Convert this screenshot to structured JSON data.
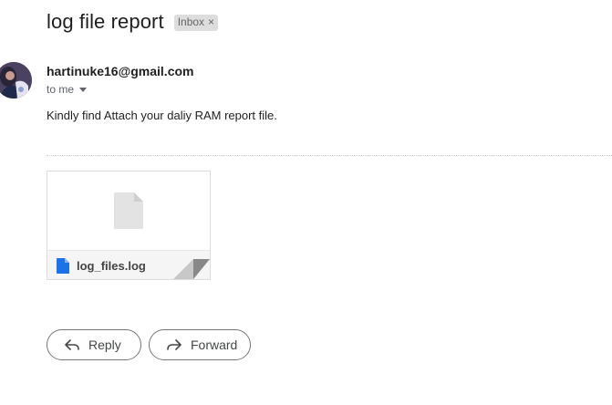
{
  "email": {
    "subject": "log file report",
    "label": "Inbox",
    "label_close": "×",
    "sender": "hartinuke16@gmail.com",
    "recipient": "to me",
    "body": "Kindly find Attach your daliy RAM report file."
  },
  "attachment": {
    "filename": "log_files.log",
    "icon": "document-icon"
  },
  "actions": {
    "reply_label": "Reply",
    "forward_label": "Forward"
  },
  "colors": {
    "chip_bg": "#dddddd",
    "doc_icon_blue": "#1a73e8",
    "border": "#747775"
  }
}
